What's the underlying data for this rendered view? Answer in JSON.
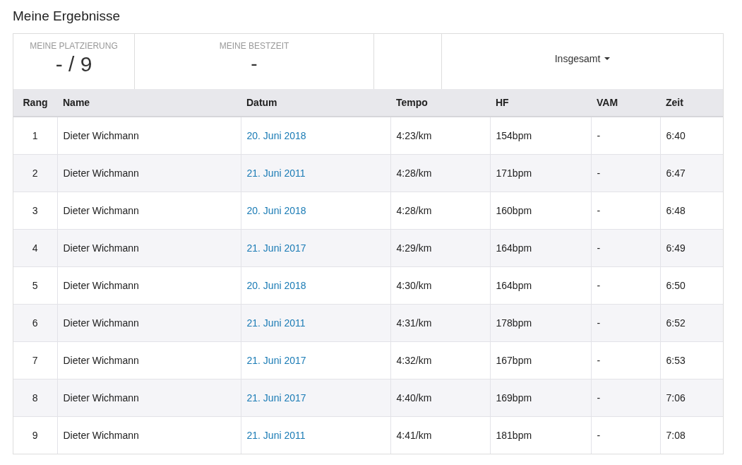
{
  "title": "Meine Ergebnisse",
  "summary": [
    {
      "label": "MEINE PLATZIERUNG",
      "value": "- / 9"
    },
    {
      "label": "MEINE BESTZEIT",
      "value": "-"
    }
  ],
  "filter": {
    "label": "Insgesamt"
  },
  "table": {
    "columns": [
      "Rang",
      "Name",
      "Datum",
      "Tempo",
      "HF",
      "VAM",
      "Zeit"
    ],
    "rows": [
      {
        "rank": "1",
        "name": "Dieter Wichmann",
        "date": "20. Juni 2018",
        "tempo": "4:23/km",
        "hf": "154bpm",
        "vam": "-",
        "time": "6:40"
      },
      {
        "rank": "2",
        "name": "Dieter Wichmann",
        "date": "21. Juni 2011",
        "tempo": "4:28/km",
        "hf": "171bpm",
        "vam": "-",
        "time": "6:47"
      },
      {
        "rank": "3",
        "name": "Dieter Wichmann",
        "date": "20. Juni 2018",
        "tempo": "4:28/km",
        "hf": "160bpm",
        "vam": "-",
        "time": "6:48"
      },
      {
        "rank": "4",
        "name": "Dieter Wichmann",
        "date": "21. Juni 2017",
        "tempo": "4:29/km",
        "hf": "164bpm",
        "vam": "-",
        "time": "6:49"
      },
      {
        "rank": "5",
        "name": "Dieter Wichmann",
        "date": "20. Juni 2018",
        "tempo": "4:30/km",
        "hf": "164bpm",
        "vam": "-",
        "time": "6:50"
      },
      {
        "rank": "6",
        "name": "Dieter Wichmann",
        "date": "21. Juni 2011",
        "tempo": "4:31/km",
        "hf": "178bpm",
        "vam": "-",
        "time": "6:52"
      },
      {
        "rank": "7",
        "name": "Dieter Wichmann",
        "date": "21. Juni 2017",
        "tempo": "4:32/km",
        "hf": "167bpm",
        "vam": "-",
        "time": "6:53"
      },
      {
        "rank": "8",
        "name": "Dieter Wichmann",
        "date": "21. Juni 2017",
        "tempo": "4:40/km",
        "hf": "169bpm",
        "vam": "-",
        "time": "7:06"
      },
      {
        "rank": "9",
        "name": "Dieter Wichmann",
        "date": "21. Juni 2011",
        "tempo": "4:41/km",
        "hf": "181bpm",
        "vam": "-",
        "time": "7:08"
      }
    ]
  }
}
